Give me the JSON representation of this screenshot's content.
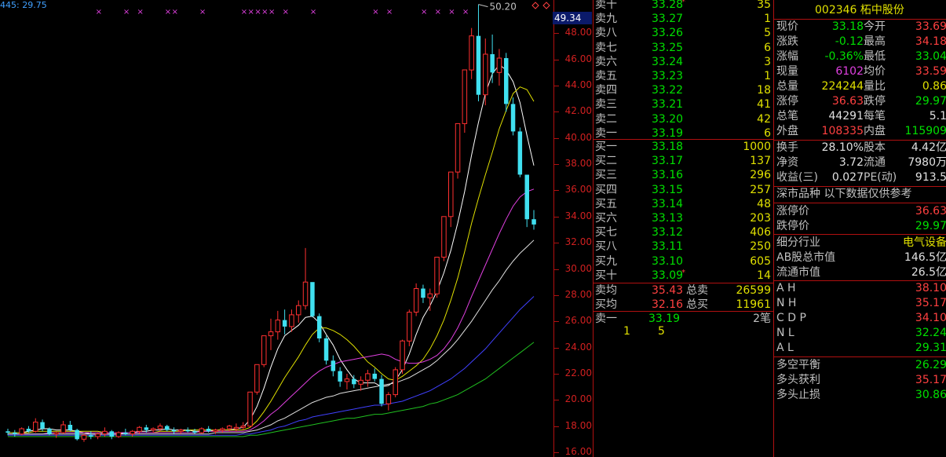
{
  "chart_header": {
    "label": "445: 29.75"
  },
  "peak_label": "50.20",
  "current_price_tag": "49.34",
  "y_axis": {
    "ticks": [
      "48.00",
      "46.00",
      "44.00",
      "42.00",
      "40.00",
      "38.00",
      "36.00",
      "34.00",
      "32.00",
      "30.00",
      "28.00",
      "26.00",
      "24.00",
      "22.00",
      "20.00",
      "18.00",
      "16.00"
    ],
    "min": 16,
    "max": 49.34
  },
  "chart_data": {
    "type": "candlestick",
    "y_range": [
      16,
      49.34
    ],
    "candles": [
      [
        17.6,
        17.8,
        17.3,
        17.5
      ],
      [
        17.5,
        17.7,
        17.2,
        17.4
      ],
      [
        17.4,
        17.9,
        17.3,
        17.8
      ],
      [
        17.8,
        18.0,
        17.5,
        17.6
      ],
      [
        17.6,
        18.6,
        17.5,
        18.3
      ],
      [
        18.3,
        18.5,
        17.6,
        17.8
      ],
      [
        17.8,
        17.9,
        17.3,
        17.4
      ],
      [
        17.4,
        17.6,
        17.1,
        17.5
      ],
      [
        17.5,
        18.4,
        17.4,
        18.1
      ],
      [
        18.1,
        18.4,
        17.6,
        17.7
      ],
      [
        17.7,
        17.8,
        16.9,
        17.0
      ],
      [
        17.0,
        17.4,
        16.8,
        17.3
      ],
      [
        17.3,
        17.6,
        17.0,
        17.2
      ],
      [
        17.2,
        17.5,
        17.0,
        17.4
      ],
      [
        17.4,
        17.9,
        17.2,
        17.6
      ],
      [
        17.6,
        17.7,
        17.0,
        17.2
      ],
      [
        17.2,
        17.6,
        17.1,
        17.5
      ],
      [
        17.5,
        17.8,
        17.3,
        17.4
      ],
      [
        17.4,
        17.7,
        17.2,
        17.6
      ],
      [
        17.6,
        18.0,
        17.4,
        17.9
      ],
      [
        17.9,
        18.1,
        17.5,
        17.7
      ],
      [
        17.7,
        17.9,
        17.5,
        17.8
      ],
      [
        17.8,
        18.2,
        17.6,
        18.0
      ],
      [
        18.0,
        18.1,
        17.6,
        17.7
      ],
      [
        17.7,
        17.9,
        17.4,
        17.6
      ],
      [
        17.6,
        17.8,
        17.4,
        17.7
      ],
      [
        17.7,
        17.9,
        17.5,
        17.6
      ],
      [
        17.6,
        17.8,
        17.4,
        17.5
      ],
      [
        17.5,
        17.9,
        17.4,
        17.8
      ],
      [
        17.8,
        18.0,
        17.5,
        17.6
      ],
      [
        17.6,
        17.8,
        17.4,
        17.7
      ],
      [
        17.7,
        17.9,
        17.5,
        17.8
      ],
      [
        17.8,
        18.1,
        17.6,
        18.0
      ],
      [
        17.8,
        18.2,
        17.6,
        17.9
      ],
      [
        17.9,
        18.3,
        17.7,
        18.0
      ],
      [
        18.0,
        20.6,
        17.9,
        20.6
      ],
      [
        20.6,
        22.7,
        20.4,
        22.7
      ],
      [
        22.7,
        24.9,
        22.5,
        24.9
      ],
      [
        24.9,
        26.2,
        23.8,
        25.2
      ],
      [
        25.2,
        26.8,
        24.6,
        26.1
      ],
      [
        26.1,
        26.9,
        25.0,
        25.6
      ],
      [
        25.6,
        26.9,
        25.2,
        26.5
      ],
      [
        26.5,
        27.6,
        25.9,
        27.2
      ],
      [
        27.2,
        31.6,
        26.9,
        29.0
      ],
      [
        29.0,
        27.9,
        26.3,
        26.4
      ],
      [
        26.4,
        26.6,
        24.4,
        24.7
      ],
      [
        24.7,
        24.9,
        22.7,
        23.0
      ],
      [
        23.0,
        23.4,
        21.8,
        22.2
      ],
      [
        22.2,
        22.5,
        21.0,
        21.4
      ],
      [
        21.4,
        22.0,
        20.8,
        21.6
      ],
      [
        21.6,
        21.9,
        20.9,
        21.2
      ],
      [
        21.2,
        21.8,
        20.7,
        21.5
      ],
      [
        21.5,
        22.3,
        21.0,
        22.0
      ],
      [
        22.0,
        22.4,
        21.4,
        21.6
      ],
      [
        21.6,
        21.9,
        19.5,
        19.7
      ],
      [
        19.7,
        20.6,
        19.2,
        20.4
      ],
      [
        20.4,
        22.5,
        20.2,
        22.3
      ],
      [
        22.3,
        24.6,
        22.0,
        24.5
      ],
      [
        24.5,
        26.9,
        24.1,
        26.7
      ],
      [
        26.7,
        28.9,
        26.4,
        28.5
      ],
      [
        28.5,
        28.8,
        27.4,
        27.8
      ],
      [
        27.8,
        28.5,
        26.8,
        28.1
      ],
      [
        28.1,
        30.9,
        27.8,
        30.9
      ],
      [
        30.9,
        34.0,
        30.6,
        34.0
      ],
      [
        34.0,
        37.4,
        33.2,
        37.4
      ],
      [
        37.4,
        41.1,
        36.9,
        41.1
      ],
      [
        41.1,
        45.2,
        40.4,
        45.2
      ],
      [
        45.2,
        48.4,
        44.5,
        47.8
      ],
      [
        47.8,
        50.2,
        42.8,
        43.3
      ],
      [
        43.3,
        47.6,
        42.5,
        46.4
      ],
      [
        46.4,
        47.9,
        44.2,
        45.0
      ],
      [
        45.0,
        46.8,
        44.0,
        46.1
      ],
      [
        46.1,
        46.5,
        42.0,
        42.6
      ],
      [
        42.6,
        43.1,
        40.2,
        40.5
      ],
      [
        40.5,
        40.8,
        37.0,
        37.2
      ],
      [
        37.2,
        36.0,
        33.2,
        33.8
      ],
      [
        33.8,
        34.5,
        33.0,
        33.4
      ]
    ],
    "ma_series": [
      {
        "color": "#ffffff",
        "values": [
          17.5,
          17.5,
          17.5,
          17.6,
          17.7,
          17.8,
          17.8,
          17.7,
          17.7,
          17.7,
          17.6,
          17.5,
          17.4,
          17.4,
          17.4,
          17.4,
          17.4,
          17.5,
          17.5,
          17.6,
          17.6,
          17.7,
          17.7,
          17.8,
          17.7,
          17.7,
          17.7,
          17.6,
          17.6,
          17.6,
          17.7,
          17.7,
          17.7,
          17.8,
          17.9,
          18.5,
          19.5,
          20.9,
          22.5,
          23.9,
          24.9,
          25.3,
          25.7,
          26.3,
          26.4,
          25.9,
          25.0,
          24.2,
          23.1,
          22.3,
          21.6,
          21.3,
          21.3,
          21.3,
          21.0,
          21.1,
          21.5,
          22.3,
          23.5,
          25.0,
          26.3,
          27.2,
          28.3,
          29.7,
          31.4,
          33.5,
          35.9,
          38.7,
          41.2,
          43.4,
          44.9,
          45.6,
          45.2,
          44.3,
          42.7,
          40.2,
          37.9
        ]
      },
      {
        "color": "#e0e000",
        "values": [
          17.5,
          17.5,
          17.5,
          17.5,
          17.6,
          17.6,
          17.6,
          17.6,
          17.6,
          17.6,
          17.6,
          17.6,
          17.6,
          17.6,
          17.5,
          17.5,
          17.5,
          17.5,
          17.5,
          17.5,
          17.5,
          17.5,
          17.6,
          17.6,
          17.6,
          17.6,
          17.7,
          17.7,
          17.7,
          17.7,
          17.7,
          17.7,
          17.7,
          17.7,
          17.7,
          17.9,
          18.4,
          19.1,
          19.9,
          20.8,
          21.7,
          22.5,
          23.3,
          24.2,
          25.0,
          25.5,
          25.5,
          25.3,
          25.0,
          24.6,
          24.1,
          23.5,
          22.9,
          22.5,
          22.0,
          21.6,
          21.5,
          21.8,
          22.2,
          22.6,
          23.1,
          23.9,
          24.9,
          26.1,
          27.6,
          29.3,
          31.3,
          33.5,
          35.4,
          37.2,
          38.9,
          40.7,
          42.1,
          43.4,
          43.9,
          43.7,
          42.8
        ]
      },
      {
        "color": "#e040e0",
        "values": [
          17.4,
          17.4,
          17.4,
          17.4,
          17.4,
          17.4,
          17.5,
          17.5,
          17.5,
          17.5,
          17.5,
          17.5,
          17.5,
          17.5,
          17.5,
          17.5,
          17.5,
          17.5,
          17.5,
          17.5,
          17.5,
          17.5,
          17.5,
          17.5,
          17.5,
          17.5,
          17.5,
          17.5,
          17.6,
          17.6,
          17.6,
          17.6,
          17.6,
          17.6,
          17.6,
          17.7,
          18.0,
          18.4,
          18.9,
          19.3,
          19.8,
          20.3,
          20.8,
          21.3,
          21.8,
          22.2,
          22.5,
          22.7,
          22.9,
          23.0,
          23.1,
          23.2,
          23.3,
          23.4,
          23.5,
          23.4,
          23.1,
          22.9,
          22.8,
          22.8,
          22.9,
          23.1,
          23.4,
          23.9,
          24.6,
          25.5,
          26.6,
          27.9,
          29.1,
          30.3,
          31.5,
          32.7,
          33.8,
          34.8,
          35.5,
          35.9,
          36.1
        ]
      },
      {
        "color": "#e0e0e0",
        "values": [
          17.4,
          17.4,
          17.4,
          17.4,
          17.4,
          17.4,
          17.4,
          17.4,
          17.4,
          17.4,
          17.4,
          17.4,
          17.4,
          17.4,
          17.4,
          17.4,
          17.4,
          17.4,
          17.4,
          17.4,
          17.4,
          17.4,
          17.4,
          17.4,
          17.4,
          17.4,
          17.4,
          17.4,
          17.4,
          17.4,
          17.5,
          17.5,
          17.5,
          17.5,
          17.5,
          17.6,
          17.7,
          17.9,
          18.1,
          18.4,
          18.6,
          18.9,
          19.2,
          19.5,
          19.8,
          20.0,
          20.2,
          20.3,
          20.5,
          20.6,
          20.7,
          20.8,
          20.9,
          21.0,
          21.1,
          21.2,
          21.3,
          21.5,
          21.7,
          22.0,
          22.3,
          22.6,
          23.0,
          23.5,
          24.0,
          24.6,
          25.3,
          26.0,
          26.8,
          27.6,
          28.4,
          29.1,
          29.9,
          30.6,
          31.2,
          31.7,
          32.2
        ]
      },
      {
        "color": "#4040ff",
        "values": [
          17.3,
          17.3,
          17.3,
          17.3,
          17.3,
          17.3,
          17.3,
          17.3,
          17.3,
          17.3,
          17.3,
          17.3,
          17.3,
          17.3,
          17.3,
          17.3,
          17.3,
          17.3,
          17.3,
          17.3,
          17.3,
          17.3,
          17.3,
          17.3,
          17.3,
          17.3,
          17.3,
          17.3,
          17.3,
          17.3,
          17.3,
          17.3,
          17.3,
          17.3,
          17.4,
          17.4,
          17.5,
          17.6,
          17.7,
          17.9,
          18.0,
          18.2,
          18.4,
          18.5,
          18.7,
          18.8,
          18.9,
          19.0,
          19.1,
          19.2,
          19.3,
          19.4,
          19.5,
          19.6,
          19.6,
          19.7,
          19.8,
          19.9,
          20.1,
          20.3,
          20.5,
          20.7,
          21.0,
          21.3,
          21.6,
          22.0,
          22.4,
          22.9,
          23.4,
          23.9,
          24.5,
          25.1,
          25.7,
          26.3,
          26.9,
          27.4,
          27.9
        ]
      },
      {
        "color": "#20c020",
        "values": [
          17.2,
          17.2,
          17.2,
          17.2,
          17.2,
          17.2,
          17.2,
          17.2,
          17.2,
          17.2,
          17.2,
          17.2,
          17.2,
          17.2,
          17.2,
          17.2,
          17.2,
          17.2,
          17.2,
          17.2,
          17.2,
          17.2,
          17.2,
          17.2,
          17.2,
          17.2,
          17.2,
          17.2,
          17.2,
          17.2,
          17.2,
          17.2,
          17.2,
          17.2,
          17.2,
          17.3,
          17.3,
          17.4,
          17.5,
          17.6,
          17.7,
          17.8,
          17.9,
          18.0,
          18.1,
          18.2,
          18.3,
          18.4,
          18.5,
          18.6,
          18.6,
          18.7,
          18.8,
          18.9,
          18.9,
          19.0,
          19.1,
          19.2,
          19.3,
          19.4,
          19.5,
          19.7,
          19.8,
          20.0,
          20.2,
          20.4,
          20.7,
          21.0,
          21.3,
          21.6,
          22.0,
          22.4,
          22.8,
          23.2,
          23.6,
          24.0,
          24.4
        ]
      }
    ],
    "top_markers": [
      13,
      17,
      19,
      23,
      24,
      28,
      34,
      35,
      36,
      37,
      38,
      40,
      44,
      53,
      55,
      60,
      62,
      64,
      66
    ]
  },
  "order_book": {
    "asks": [
      {
        "label": "卖十",
        "price": "33.28",
        "vol": "35",
        "mark": "*"
      },
      {
        "label": "卖九",
        "price": "33.27",
        "vol": "1",
        "mark": ""
      },
      {
        "label": "卖八",
        "price": "33.26",
        "vol": "5",
        "mark": ""
      },
      {
        "label": "卖七",
        "price": "33.25",
        "vol": "6",
        "mark": ""
      },
      {
        "label": "卖六",
        "price": "33.24",
        "vol": "3",
        "mark": ""
      },
      {
        "label": "卖五",
        "price": "33.23",
        "vol": "1",
        "mark": ""
      },
      {
        "label": "卖四",
        "price": "33.22",
        "vol": "18",
        "mark": ""
      },
      {
        "label": "卖三",
        "price": "33.21",
        "vol": "41",
        "mark": ""
      },
      {
        "label": "卖二",
        "price": "33.20",
        "vol": "42",
        "mark": ""
      },
      {
        "label": "卖一",
        "price": "33.19",
        "vol": "6",
        "mark": ""
      }
    ],
    "bids": [
      {
        "label": "买一",
        "price": "33.18",
        "vol": "1000",
        "mark": ""
      },
      {
        "label": "买二",
        "price": "33.17",
        "vol": "137",
        "mark": ""
      },
      {
        "label": "买三",
        "price": "33.16",
        "vol": "296",
        "mark": ""
      },
      {
        "label": "买四",
        "price": "33.15",
        "vol": "257",
        "mark": ""
      },
      {
        "label": "买五",
        "price": "33.14",
        "vol": "48",
        "mark": ""
      },
      {
        "label": "买六",
        "price": "33.13",
        "vol": "203",
        "mark": ""
      },
      {
        "label": "买七",
        "price": "33.12",
        "vol": "406",
        "mark": ""
      },
      {
        "label": "买八",
        "price": "33.11",
        "vol": "250",
        "mark": ""
      },
      {
        "label": "买九",
        "price": "33.10",
        "vol": "605",
        "mark": ""
      },
      {
        "label": "买十",
        "price": "33.09",
        "vol": "14",
        "mark": "*"
      }
    ],
    "avg_ask": {
      "label": "卖均",
      "price": "35.43",
      "total_label": "总卖",
      "total": "26599"
    },
    "avg_bid": {
      "label": "买均",
      "price": "32.16",
      "total_label": "总买",
      "total": "11961"
    },
    "last": {
      "label": "卖一",
      "price": "33.19",
      "vol": "2笔",
      "n1": "1",
      "n2": "5"
    }
  },
  "stock": {
    "code": "002346",
    "name": "柘中股份"
  },
  "quote": [
    {
      "l1": "现价",
      "v1": "33.18",
      "c1": "green",
      "l2": "今开",
      "v2": "33.69",
      "c2": "red"
    },
    {
      "l1": "涨跌",
      "v1": "-0.12",
      "c1": "green",
      "l2": "最高",
      "v2": "34.18",
      "c2": "red"
    },
    {
      "l1": "涨幅",
      "v1": "-0.36%",
      "c1": "green",
      "l2": "最低",
      "v2": "33.04",
      "c2": "green"
    },
    {
      "l1": "现量",
      "v1": "6102",
      "c1": "magenta",
      "l2": "均价",
      "v2": "33.59",
      "c2": "red"
    },
    {
      "l1": "总量",
      "v1": "224244",
      "c1": "yellow",
      "l2": "量比",
      "v2": "0.86",
      "c2": "yellow"
    },
    {
      "l1": "涨停",
      "v1": "36.63",
      "c1": "red",
      "l2": "跌停",
      "v2": "29.97",
      "c2": "green"
    },
    {
      "l1": "总笔",
      "v1": "44291",
      "c1": "white",
      "l2": "每笔",
      "v2": "5.1",
      "c2": "white"
    },
    {
      "l1": "外盘",
      "v1": "108335",
      "c1": "red",
      "l2": "内盘",
      "v2": "115909",
      "c2": "green"
    }
  ],
  "fund": [
    {
      "l1": "换手",
      "v1": "28.10%",
      "c1": "white",
      "l2": "股本",
      "v2": "4.42亿",
      "c2": "white"
    },
    {
      "l1": "净资",
      "v1": "3.72",
      "c1": "white",
      "l2": "流通",
      "v2": "7980万",
      "c2": "white"
    },
    {
      "l1": "收益(三)",
      "v1": "0.027",
      "c1": "white",
      "l2": "PE(动)",
      "v2": "913.5",
      "c2": "white"
    }
  ],
  "market_note": "深市品种  以下数据仅供参考",
  "limits": [
    {
      "l": "涨停价",
      "v": "36.63",
      "c": "red"
    },
    {
      "l": "跌停价",
      "v": "29.97",
      "c": "green"
    }
  ],
  "industry": [
    {
      "l": "细分行业",
      "v": "电气设备",
      "c": "yellow"
    },
    {
      "l": "AB股总市值",
      "v": "146.5亿",
      "c": "white"
    },
    {
      "l": "流通市值",
      "v": "26.5亿",
      "c": "white"
    }
  ],
  "indicators": [
    {
      "l": "A H",
      "v": "38.10",
      "c": "red"
    },
    {
      "l": "N H",
      "v": "35.17",
      "c": "red"
    },
    {
      "l": "C D P",
      "v": "34.10",
      "c": "red"
    },
    {
      "l": "N L",
      "v": "32.24",
      "c": "green"
    },
    {
      "l": "A L",
      "v": "29.31",
      "c": "green"
    }
  ],
  "balance": [
    {
      "l": "多空平衡",
      "v": "26.29",
      "c": "green"
    },
    {
      "l": "多头获利",
      "v": "35.17",
      "c": "red"
    },
    {
      "l": "多头止损",
      "v": "30.86",
      "c": "green"
    }
  ]
}
